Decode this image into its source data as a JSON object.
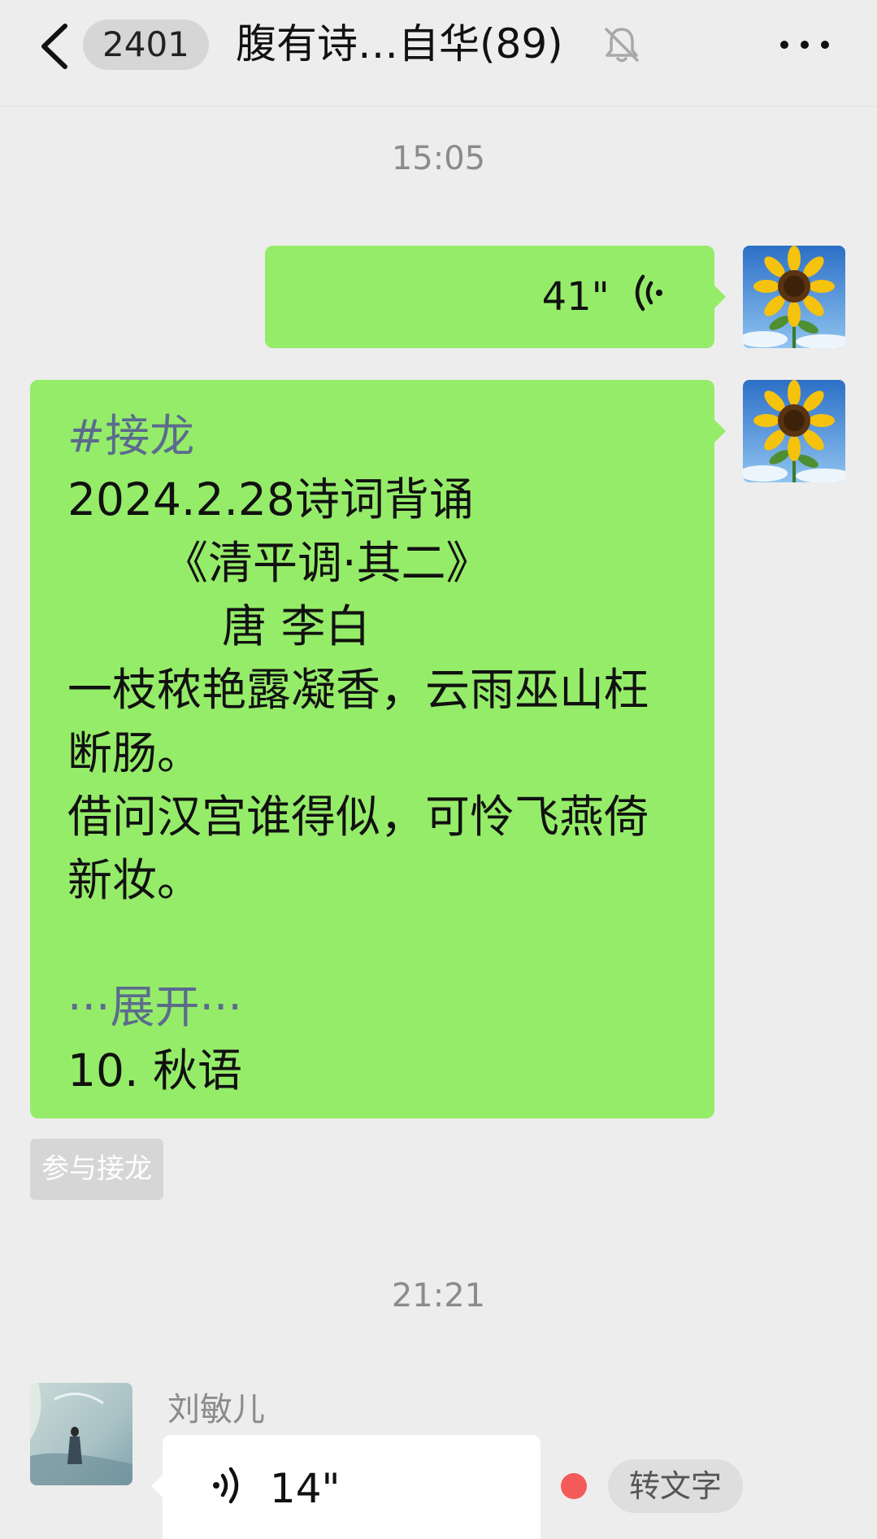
{
  "header": {
    "unread_count": "2401",
    "title": "腹有诗…自华(89)"
  },
  "messages": {
    "time_1": "15:05",
    "voice_out_duration": "41\"",
    "text_lines": [
      "#接龙",
      "2024.2.28诗词背诵",
      "《清平调·其二》",
      "唐 李白",
      "一枝秾艳露凝香，云雨巫山枉",
      "断肠。",
      "借问汉宫谁得似，可怜飞燕倚",
      "新妆。",
      "",
      "···展开···",
      "10. 秋语"
    ],
    "join_button": "参与接龙",
    "time_2": "21:21",
    "sender_name": "刘敏儿",
    "voice_in_duration": "14\"",
    "to_text_button": "转文字"
  },
  "colors": {
    "background": "#ededed",
    "bubble_green": "#95ec69",
    "link_blue": "#5b6b8d",
    "unread_dot": "#f55a5a"
  },
  "icons": [
    "back-arrow-icon",
    "mute-bell-icon",
    "more-icon",
    "voice-wave-icon"
  ]
}
